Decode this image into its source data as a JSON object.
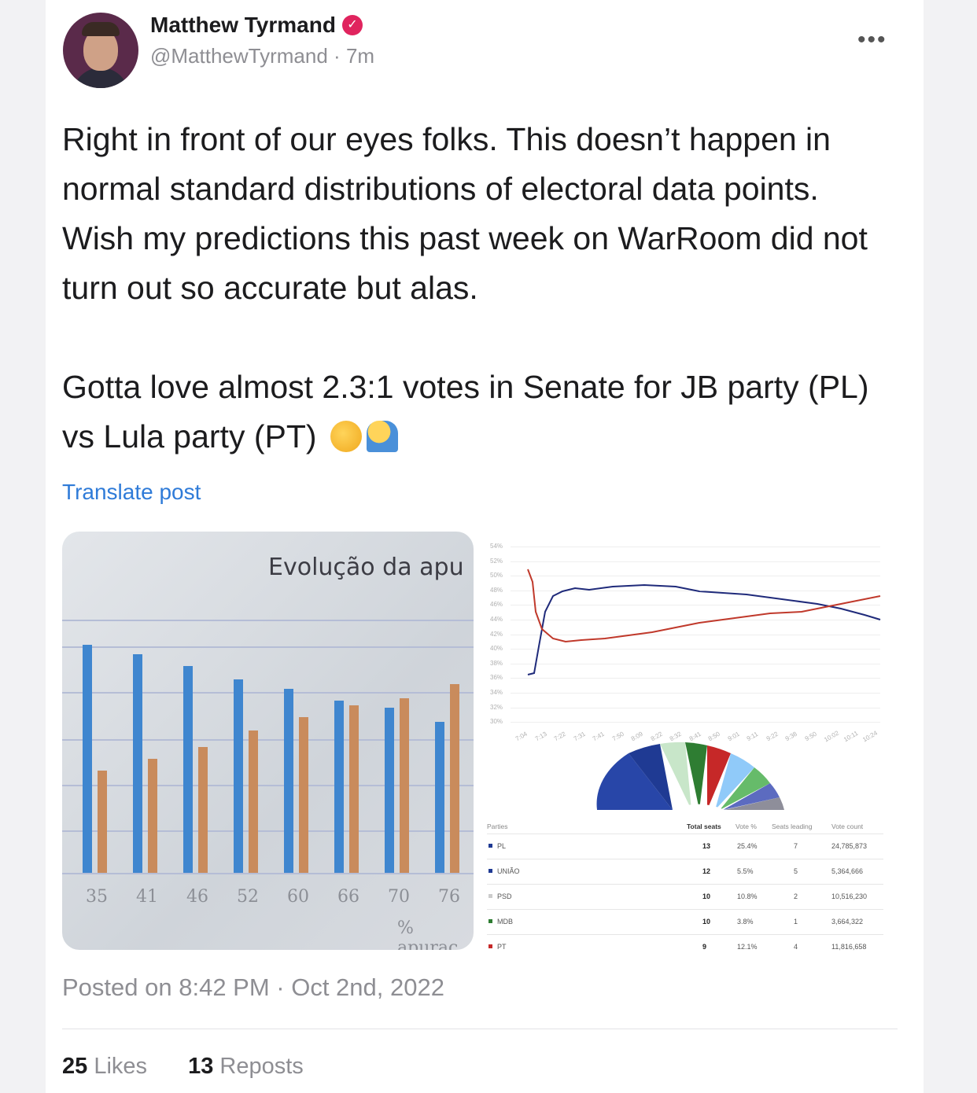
{
  "post": {
    "author_name": "Matthew Tyrmand",
    "verified_mark": "✓",
    "handle": "@MatthewTyrmand",
    "time_separator": "·",
    "time_ago": "7m",
    "more_glyph": "•••",
    "text_p1": "Right in front of our eyes folks. This doesn’t happen in normal standard distributions of electoral data points. Wish my predictions this past week on WarRoom did not turn out so accurate but alas.",
    "text_p2": "Gotta love almost 2.3:1 votes in Senate for JB party (PL) vs Lula party (PT)",
    "emoji_icons": [
      "thinking-face-emoji",
      "facepalm-emoji"
    ],
    "translate_label": "Translate post",
    "posted_label": "Posted on 8:42 PM · Oct 2nd, 2022",
    "likes_count": "25",
    "likes_label": "Likes",
    "reposts_count": "13",
    "reposts_label": "Reposts"
  },
  "photo_chart": {
    "title": "Evolução da apu",
    "x_caption": "% apurac",
    "categories": [
      "35",
      "41",
      "46",
      "52",
      "60",
      "66",
      "70",
      "76"
    ],
    "blue_levels": [
      0.98,
      0.94,
      0.89,
      0.83,
      0.79,
      0.74,
      0.71,
      0.65
    ],
    "orange_levels": [
      0.44,
      0.49,
      0.54,
      0.61,
      0.67,
      0.72,
      0.75,
      0.81
    ],
    "colors": {
      "blue": "#3f86cf",
      "orange": "#c98b5c"
    }
  },
  "line_chart": {
    "y_ticks": [
      "54%",
      "52%",
      "50%",
      "48%",
      "46%",
      "44%",
      "42%",
      "40%",
      "38%",
      "36%",
      "34%",
      "32%",
      "30%"
    ],
    "x_ticks": [
      "7:04",
      "7:13",
      "7:22",
      "7:31",
      "7:41",
      "7:50",
      "8:09",
      "8:22",
      "8:32",
      "8:41",
      "8:50",
      "9:01",
      "9:11",
      "9:22",
      "9:38",
      "9:50",
      "10:02",
      "10:11",
      "10:24"
    ],
    "colors": {
      "blue": "#1f2a7a",
      "red": "#c0392b"
    }
  },
  "seat_table": {
    "headers": [
      "Parties",
      "Total seats",
      "Vote %",
      "Seats leading",
      "Vote count"
    ],
    "rows": [
      {
        "party": "PL",
        "color": "#1f3a93",
        "seats": "13",
        "vote_pct": "25.4%",
        "leading": "7",
        "count": "24,785,873"
      },
      {
        "party": "UNIÃO",
        "color": "#1f3a93",
        "seats": "12",
        "vote_pct": "5.5%",
        "leading": "5",
        "count": "5,364,666"
      },
      {
        "party": "PSD",
        "color": "#cccccc",
        "seats": "10",
        "vote_pct": "10.8%",
        "leading": "2",
        "count": "10,516,230"
      },
      {
        "party": "MDB",
        "color": "#2e7d32",
        "seats": "10",
        "vote_pct": "3.8%",
        "leading": "1",
        "count": "3,664,322"
      },
      {
        "party": "PT",
        "color": "#c62828",
        "seats": "9",
        "vote_pct": "12.1%",
        "leading": "4",
        "count": "11,816,658"
      }
    ]
  }
}
